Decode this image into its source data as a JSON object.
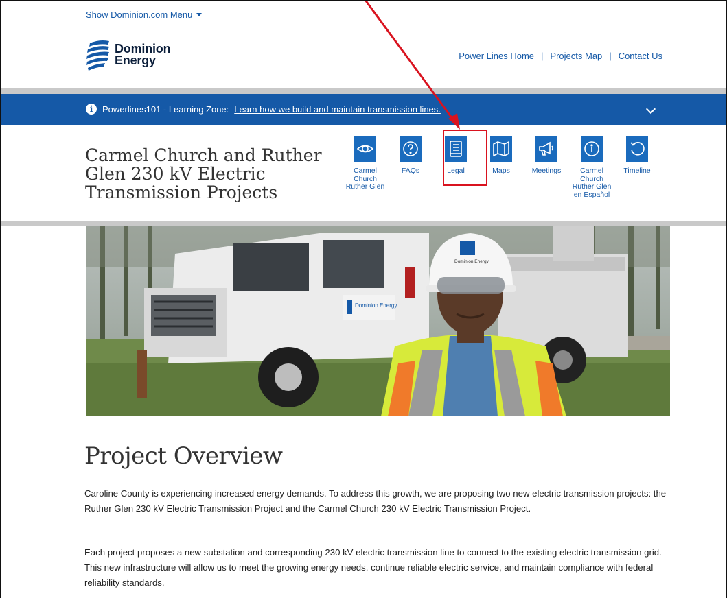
{
  "header": {
    "menu_toggle": "Show Dominion.com Menu",
    "logo_line1": "Dominion",
    "logo_line2": "Energy",
    "links": [
      "Power Lines Home",
      "Projects Map",
      "Contact Us"
    ],
    "separator": "|"
  },
  "banner": {
    "prefix": "Powerlines101 - Learning Zone:",
    "link": "Learn how we build and maintain transmission lines.",
    "info_glyph": "i"
  },
  "project": {
    "title": "Carmel Church and Ruther Glen 230 kV Electric Transmission Projects",
    "nav": [
      {
        "label": "Carmel Church Ruther Glen",
        "icon": "eye-icon"
      },
      {
        "label": "FAQs",
        "icon": "question-icon"
      },
      {
        "label": "Legal",
        "icon": "book-icon"
      },
      {
        "label": "Maps",
        "icon": "map-icon"
      },
      {
        "label": "Meetings",
        "icon": "megaphone-icon"
      },
      {
        "label": "Carmel Church Ruther Glen en Español",
        "icon": "info-icon"
      },
      {
        "label": "Timeline",
        "icon": "undo-icon"
      }
    ]
  },
  "hero": {
    "truck_logo": "Dominion Energy",
    "helmet_logo": "Dominion Energy"
  },
  "overview": {
    "title": "Project Overview",
    "paragraph1": "Caroline County is experiencing increased energy demands. To address this growth, we are proposing two new electric transmission projects: the Ruther Glen 230 kV Electric Transmission Project and the Carmel Church 230 kV Electric Transmission Project.",
    "paragraph2": "Each project proposes a new substation and corresponding 230 kV electric transmission line to connect to the existing electric transmission grid. This new infrastructure will allow us to meet the growing energy needs, continue reliable electric service, and maintain compliance with federal reliability standards."
  },
  "colors": {
    "brand_blue": "#1559a7",
    "icon_blue": "#1a6bbd",
    "annotation_red": "#d9131f"
  }
}
